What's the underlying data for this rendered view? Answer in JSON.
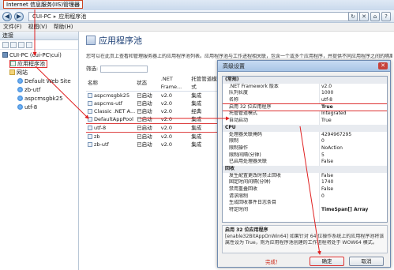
{
  "window": {
    "title": "Internet 信息服务(IIS)管理器"
  },
  "address": {
    "parts": [
      "CUI-PC",
      "应用程序池"
    ],
    "separator": "▸"
  },
  "menu": [
    "文件(F)",
    "视图(V)",
    "帮助(H)"
  ],
  "connections": {
    "header": "连接",
    "tree": [
      {
        "label": "CUI-PC (cui-PC\\cui)",
        "icon": "server-icon"
      },
      {
        "label": "应用程序池",
        "icon": "app-pool-icon",
        "selected": true
      },
      {
        "label": "网站",
        "icon": "folder-icon"
      },
      {
        "label": "Default Web Site",
        "icon": "globe-icon"
      },
      {
        "label": "zb-utf",
        "icon": "globe-icon"
      },
      {
        "label": "aspcmsgbk25",
        "icon": "globe-icon"
      },
      {
        "label": "utf-8",
        "icon": "globe-icon"
      }
    ]
  },
  "main": {
    "title": "应用程序池",
    "description": "您可以在此页上查看和管理服务器上的应用程序池列表。应用程序池与工作进程相关联，包含一个或多个应用程序，并提供不同应用程序之间的隔离。",
    "filter_label": "筛选:",
    "columns": [
      "名称",
      "状态",
      ".NET Frame...",
      "托管管道模式"
    ],
    "rows": [
      [
        "aspcmsgbk25",
        "已启动",
        "v2.0",
        "集成"
      ],
      [
        "aspcms-utf",
        "已启动",
        "v2.0",
        "集成"
      ],
      [
        "Classic .NET A...",
        "已启动",
        "v2.0",
        "经典"
      ],
      [
        "DefaultAppPool",
        "已启动",
        "v2.0",
        "集成"
      ],
      [
        "utf-8",
        "已启动",
        "v2.0",
        "集成"
      ],
      [
        "zb",
        "已启动",
        "v2.0",
        "集成"
      ],
      [
        "zb-utf",
        "已启动",
        "v2.0",
        "集成"
      ]
    ]
  },
  "dialog": {
    "title": "高级设置",
    "close": "✕",
    "properties": [
      {
        "name": "(常规)",
        "value": "",
        "cat": true
      },
      {
        "name": ".NET Framework 版本",
        "value": "v2.0"
      },
      {
        "name": "队列长度",
        "value": "1000"
      },
      {
        "name": "名称",
        "value": "utf-8"
      },
      {
        "name": "启用 32 位应用程序",
        "value": "True",
        "hi": true
      },
      {
        "name": "托管管道模式",
        "value": "Integrated"
      },
      {
        "name": "自动启动",
        "value": "True"
      },
      {
        "name": "CPU",
        "value": "",
        "cat": true
      },
      {
        "name": "处理器关联掩码",
        "value": "4294967295"
      },
      {
        "name": "限制",
        "value": "0"
      },
      {
        "name": "限制操作",
        "value": "NoAction"
      },
      {
        "name": "限制间隔(分钟)",
        "value": "5"
      },
      {
        "name": "已启用处理器关联",
        "value": "False"
      },
      {
        "name": "回收",
        "value": "",
        "cat": true
      },
      {
        "name": "发生配置更改时禁止回收",
        "value": "False"
      },
      {
        "name": "固定时间间隔(分钟)",
        "value": "1740"
      },
      {
        "name": "禁用重叠回收",
        "value": "False"
      },
      {
        "name": "请求限制",
        "value": "0"
      },
      {
        "name": "生成回收事件日志条目",
        "value": ""
      },
      {
        "name": "特定时间",
        "value": "TimeSpan[] Array",
        "bold": true
      }
    ],
    "desc_title": "启用 32 位应用程序",
    "desc_line1": "[enable32BitAppOnWin64] 如果针对 64 位操作系统上的应用程序池将该",
    "desc_line2": "属性设为 True，则为应用程序池创建的工作进程将处于 WOW64 模式。",
    "done_label": "完成！",
    "ok": "确定",
    "cancel": "取消"
  }
}
